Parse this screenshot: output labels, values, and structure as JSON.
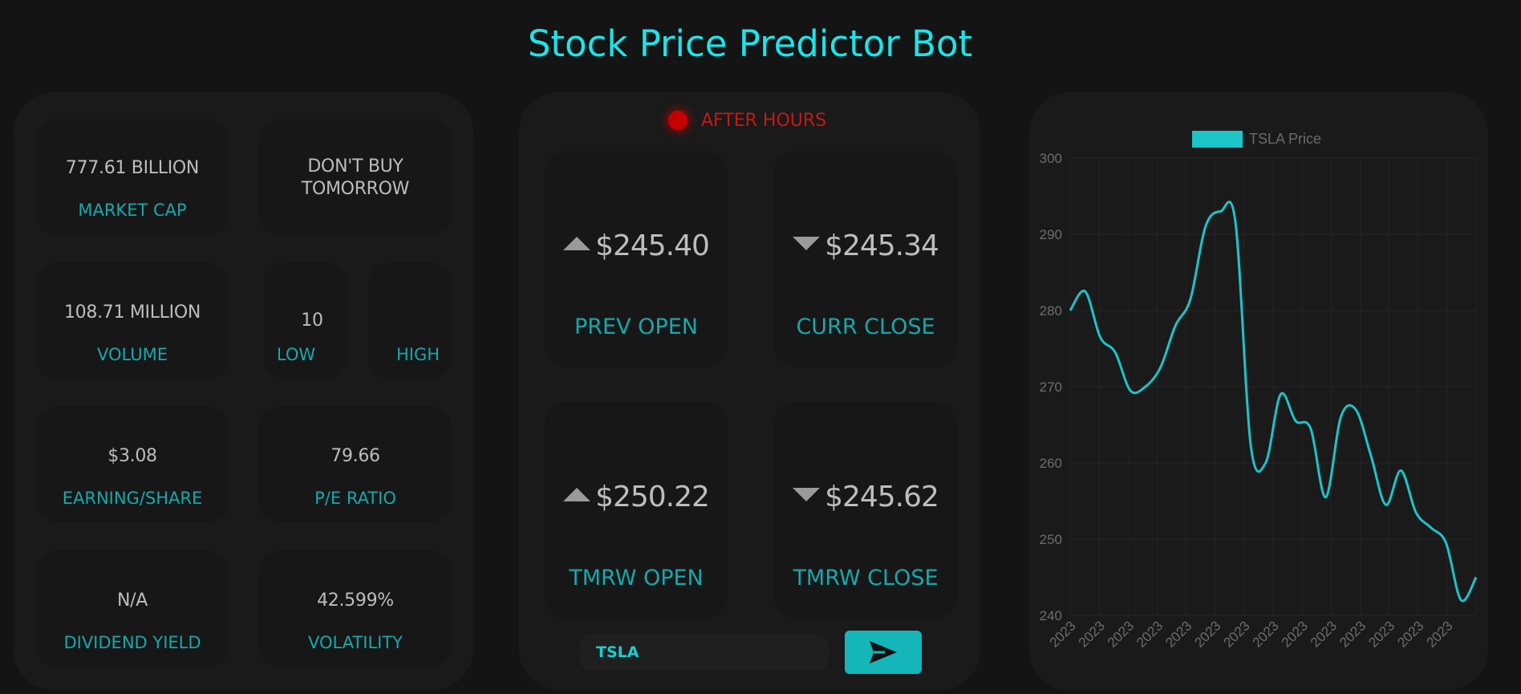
{
  "header": {
    "title": "Stock Price Predictor Bot"
  },
  "stats": {
    "market_cap": {
      "value": "777.61 BILLION",
      "label": "MARKET CAP"
    },
    "recommendation": {
      "value": "DON'T BUY TOMORROW"
    },
    "volume": {
      "value": "108.71 MILLION",
      "label": "VOLUME"
    },
    "low": {
      "value": "10",
      "label": "LOW"
    },
    "high": {
      "value": "",
      "label": "HIGH"
    },
    "eps": {
      "value": "$3.08",
      "label": "EARNING/SHARE"
    },
    "pe": {
      "value": "79.66",
      "label": "P/E RATIO"
    },
    "dividend": {
      "value": "N/A",
      "label": "DIVIDEND YIELD"
    },
    "volatility": {
      "value": "42.599%",
      "label": "VOLATILITY"
    }
  },
  "status": {
    "text": "AFTER HOURS",
    "color": "#c51818"
  },
  "prices": {
    "prev_open": {
      "value": "$245.40",
      "label": "PREV OPEN",
      "direction": "up"
    },
    "curr_close": {
      "value": "$245.34",
      "label": "CURR CLOSE",
      "direction": "down"
    },
    "tmrw_open": {
      "value": "$250.22",
      "label": "TMRW OPEN",
      "direction": "up"
    },
    "tmrw_close": {
      "value": "$245.62",
      "label": "TMRW CLOSE",
      "direction": "down"
    }
  },
  "ticker_input": {
    "value": "TSLA"
  },
  "send_button": {
    "icon": "send-icon"
  },
  "colors": {
    "accent": "#19e6ea",
    "label": "#17a8ab",
    "button": "#15b6ba",
    "line": "#1dc4c8"
  },
  "chart_data": {
    "type": "line",
    "legend": "TSLA Price",
    "legend_position": "top",
    "ylim": [
      240,
      300
    ],
    "yticks": [
      240,
      250,
      260,
      270,
      280,
      290,
      300
    ],
    "x_tick_labels": [
      "2023",
      "2023",
      "2023",
      "2023",
      "2023",
      "2023",
      "2023",
      "2023",
      "2023",
      "2023",
      "2023",
      "2023",
      "2023",
      "2023"
    ],
    "grid": true,
    "series": [
      {
        "name": "TSLA Price",
        "values": [
          280,
          282.5,
          276.5,
          274.5,
          269.5,
          270,
          272.5,
          278,
          281.5,
          291,
          293,
          291.5,
          262.5,
          260,
          269,
          265.5,
          264.5,
          255.5,
          266,
          267,
          261,
          254.5,
          259,
          253.5,
          251.5,
          249.5,
          242,
          245
        ]
      }
    ]
  }
}
